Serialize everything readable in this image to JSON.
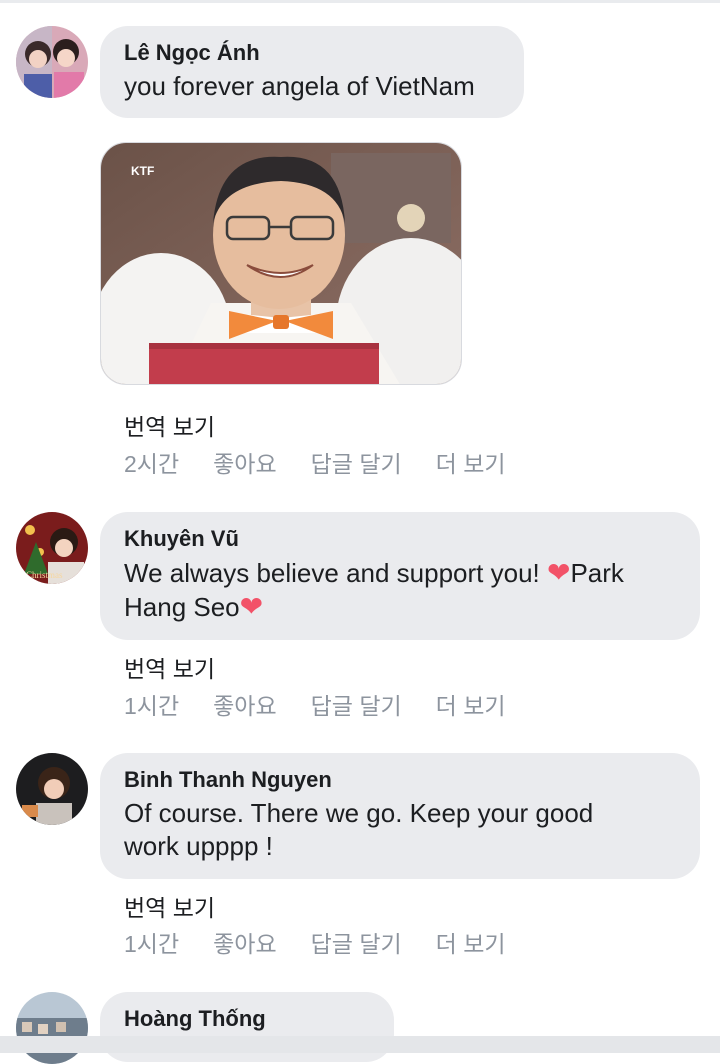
{
  "comments": [
    {
      "author": "Lê Ngọc Ánh",
      "text": "you forever angela of VietNam",
      "has_image": true,
      "image_watermark": "KTF",
      "translate": "번역 보기",
      "time": "2시간",
      "like": "좋아요",
      "reply": "답글 달기",
      "more": "더 보기"
    },
    {
      "author": "Khuyên Vũ",
      "text_part1": "We always believe and support you! ",
      "text_part2": "Park",
      "text_part3": "Hang Seo",
      "heart_glyph": "❤",
      "translate": "번역 보기",
      "time": "1시간",
      "like": "좋아요",
      "reply": "답글 달기",
      "more": "더 보기"
    },
    {
      "author": "Binh Thanh Nguyen",
      "text": "Of course. There we go. Keep your good work upppp !",
      "translate": "번역 보기",
      "time": "1시간",
      "like": "좋아요",
      "reply": "답글 달기",
      "more": "더 보기"
    },
    {
      "author": "Hoàng Thống"
    }
  ],
  "colors": {
    "bubble": "#eaebee",
    "meta_text": "#8d949e",
    "heart": "#f25268"
  }
}
